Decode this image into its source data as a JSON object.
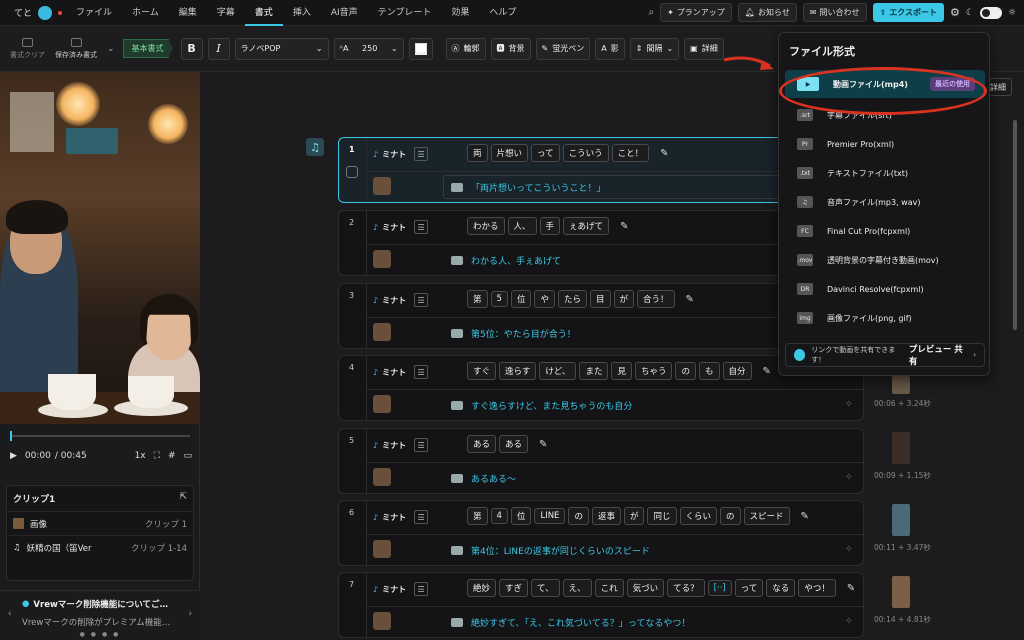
{
  "menubar": {
    "user": "てと",
    "items": [
      "ファイル",
      "ホーム",
      "編集",
      "字幕",
      "書式",
      "挿入",
      "AI音声",
      "テンプレート",
      "効果",
      "ヘルプ"
    ],
    "active": "書式",
    "plan": "プランアップ",
    "notify": "お知らせ",
    "contact": "問い合わせ",
    "export": "エクスポート"
  },
  "toolbar": {
    "clear": "書式クリア",
    "saved": "保存済み書式",
    "preset": "基本書式",
    "bold": "B",
    "italic": "I",
    "font": "ラノベPOP",
    "size": "250",
    "outline": "輪郭",
    "background": "背景",
    "highlight": "蛍光ペン",
    "shadow": "影",
    "spacing": "間隔",
    "detail": "詳細"
  },
  "player": {
    "current": "00:00",
    "total": "/ 00:45",
    "speed": "1x"
  },
  "clip": {
    "title": "クリップ1",
    "rows": [
      {
        "name": "画像",
        "range": "クリップ 1"
      },
      {
        "name": "妖精の国（笛Ver",
        "range": "クリップ 1-14"
      }
    ]
  },
  "notice": {
    "title": "Vrewマーク削除機能についてご…",
    "sub": "Vrewマークの削除がプレミアム機能…"
  },
  "rows": [
    {
      "num": "1",
      "speaker": "ミナト",
      "words": [
        "両",
        "片想い",
        "って",
        "こういう",
        "こと！"
      ],
      "subtitle": "「両片想いってこういうこと！」"
    },
    {
      "num": "2",
      "speaker": "ミナト",
      "words": [
        "わかる",
        "人、",
        "手",
        "ぇあげて"
      ],
      "subtitle": "わかる人、手ぇあげて"
    },
    {
      "num": "3",
      "speaker": "ミナト",
      "words": [
        "第",
        "5",
        "位",
        "や",
        "たら",
        "目",
        "が",
        "合う！"
      ],
      "subtitle": "第5位：やたら目が合う！"
    },
    {
      "num": "4",
      "speaker": "ミナト",
      "words": [
        "すぐ",
        "逸らす",
        "けど、",
        "また",
        "見",
        "ちゃう",
        "の",
        "も",
        "自分"
      ],
      "subtitle": "すぐ逸らすけど、また見ちゃうのも自分"
    },
    {
      "num": "5",
      "speaker": "ミナト",
      "words": [
        "ある",
        "ある"
      ],
      "subtitle": "あるある～"
    },
    {
      "num": "6",
      "speaker": "ミナト",
      "words": [
        "第",
        "4",
        "位",
        "LINE",
        "の",
        "返事",
        "が",
        "同じ",
        "くらい",
        "の",
        "スピード"
      ],
      "subtitle": "第4位：LINEの返事が同じくらいのスピード"
    },
    {
      "num": "7",
      "speaker": "ミナト",
      "words": [
        "絶妙",
        "すぎ",
        "て、",
        "え、",
        "これ",
        "気づい",
        "てる？",
        "[··]",
        "って",
        "なる",
        "やつ！"
      ],
      "subtitle": "絶妙すぎて、「え、これ気づいてる？」ってなるやつ！"
    }
  ],
  "side_times": [
    "00:06 + 3.24秒",
    "00:09 + 1.15秒",
    "00:11 + 3.47秒",
    "00:14 + 4.81秒"
  ],
  "detail_chip": "詳細",
  "export_menu": {
    "title": "ファイル形式",
    "items": [
      {
        "icon": "▶",
        "label": "動画ファイル(mp4)"
      },
      {
        "icon": ".srt",
        "label": "字幕ファイル(srt)"
      },
      {
        "icon": "Pr",
        "label": "Premier Pro(xml)"
      },
      {
        "icon": ".txt",
        "label": "テキストファイル(txt)"
      },
      {
        "icon": "♫",
        "label": "音声ファイル(mp3, wav)"
      },
      {
        "icon": "FC",
        "label": "Final Cut Pro(fcpxml)"
      },
      {
        "icon": ".mov",
        "label": "透明背景の字幕付き動画(mov)"
      },
      {
        "icon": "DR",
        "label": "Davinci Resolve(fcpxml)"
      },
      {
        "icon": "img",
        "label": "画像ファイル(png, gif)"
      }
    ],
    "recent": "最近の使用",
    "share_text": "リンクで動画を共有できます！",
    "share_btn": "プレビュー 共有"
  },
  "colors": {
    "accent": "#3bc8e6",
    "annotation": "#d9331f"
  }
}
